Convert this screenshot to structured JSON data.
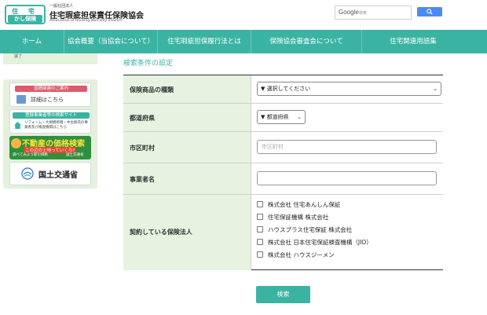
{
  "header": {
    "logo_top": "住 宅",
    "logo_bottom": "かし保険",
    "org_small": "一般社団法人",
    "org_name": "住宅瑕疵担保責任保険協会",
    "org_en": "Association of Housing Warranty Insurers",
    "search_label": "Google",
    "search_placeholder": "検索"
  },
  "nav": {
    "items": [
      {
        "label": "ホーム"
      },
      {
        "label": "協会概要（当協会について）"
      },
      {
        "label": "住宅瑕疵担保履行法とは"
      },
      {
        "label": "保険協会審査会について"
      },
      {
        "label": "住宅関連用語集"
      }
    ]
  },
  "sidebar": {
    "top_text": "議了",
    "banner1_head": "普籍関連のご案内",
    "banner1_text": "詳細はこちら",
    "banner2_head": "登録事業者等の検索サイト",
    "banner2_text": "リフォーム・大規模修繕・中古販売の事業者及び検査機関はこちら",
    "banner3_title": "不動産の価格検索",
    "banner3_sub": "この辺の土地っていくら?",
    "banner3_low": "調べてみよう取引価格",
    "banner3_mlit": "国土交通省",
    "banner4_text": "国土交通省"
  },
  "main": {
    "section_title": "検索条件の設定",
    "rows": {
      "product": {
        "label": "保険商品の種類",
        "value": "▼ 選択してください"
      },
      "prefecture": {
        "label": "都道府県",
        "value": "▼ 都道府県"
      },
      "city": {
        "label": "市区町村",
        "placeholder": "市区町村"
      },
      "business": {
        "label": "事業者名"
      },
      "insurer": {
        "label": "契約している保険法人",
        "options": [
          "株式会社 住宅あんしん保証",
          "住宅保証機構 株式会社",
          "ハウスプラス住宅保証 株式会社",
          "株式会社 日本住宅保証検査機構（JIO）",
          "株式会社 ハウスジーメン"
        ]
      }
    },
    "submit_label": "検索"
  },
  "colors": {
    "accent": "#3bb3a3",
    "label_bg": "#e7f3e0",
    "sidebar_bg": "#e3f1dd",
    "search_button": "#4c8bf5"
  }
}
